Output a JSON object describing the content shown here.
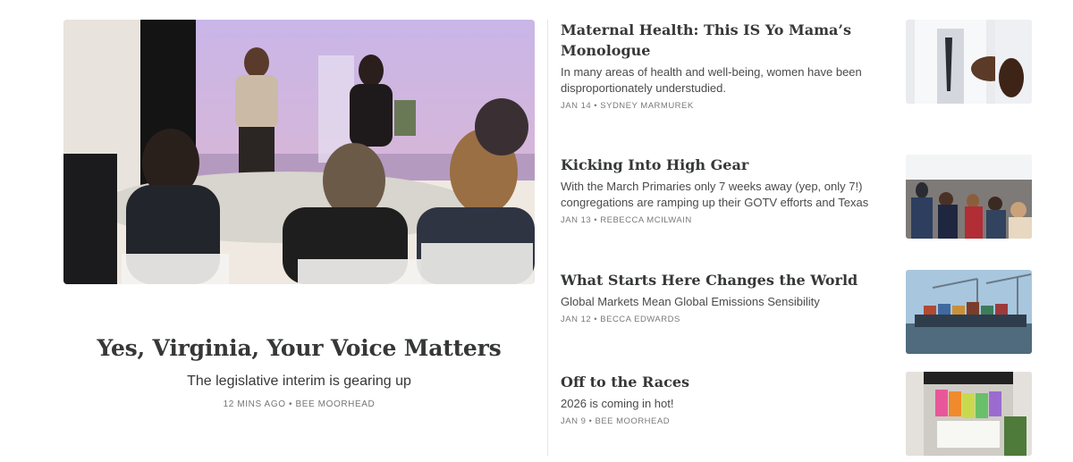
{
  "featured": {
    "title": "Yes, Virginia, Your Voice Matters",
    "subtitle": "The legislative interim is gearing up",
    "time": "12 MINS AGO",
    "author": "BEE MOORHEAD",
    "meta_sep": "•"
  },
  "posts": [
    {
      "title": "Maternal Health: This IS Yo Mama’s Monologue",
      "subtitle": "In many areas of health and well-being, women have been disproportionately understudied.",
      "date": "JAN 14",
      "author": "SYDNEY MARMUREK"
    },
    {
      "title": "Kicking Into High Gear",
      "subtitle": "With the March Primaries only 7 weeks away (yep, only 7!) congregations are ramping up their GOTV efforts and Texas",
      "date": "JAN 13",
      "author": "REBECCA MCILWAIN"
    },
    {
      "title": "What Starts Here Changes the World",
      "subtitle": "Global Markets Mean Global Emissions Sensibility",
      "date": "JAN 12",
      "author": "BECCA EDWARDS"
    },
    {
      "title": "Off to the Races",
      "subtitle": "2026 is coming in hot!",
      "date": "JAN 9",
      "author": "BEE MOORHEAD"
    }
  ]
}
